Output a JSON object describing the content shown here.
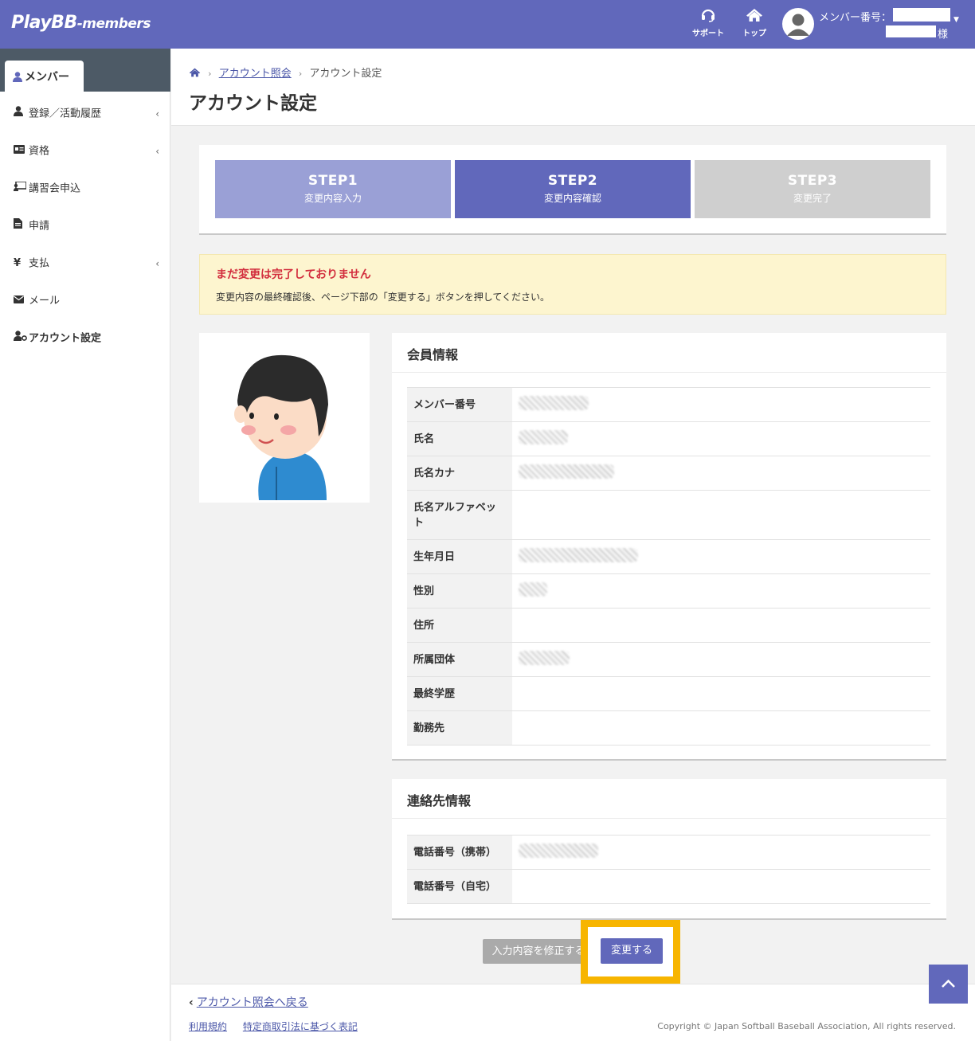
{
  "header": {
    "logo_main": "PlayBB",
    "logo_sub": "-members",
    "support_label": "サポート",
    "top_label": "トップ",
    "member_number_label": "メンバー番号：",
    "honorific": "様"
  },
  "sidebar": {
    "active_tab": "メンバー",
    "items": [
      {
        "label": "登録／活動履歴",
        "icon": "user-icon",
        "has_submenu": true
      },
      {
        "label": "資格",
        "icon": "id-card-icon",
        "has_submenu": true
      },
      {
        "label": "講習会申込",
        "icon": "chalkboard-icon",
        "has_submenu": false
      },
      {
        "label": "申請",
        "icon": "document-icon",
        "has_submenu": false
      },
      {
        "label": "支払",
        "icon": "yen-icon",
        "has_submenu": true
      },
      {
        "label": "メール",
        "icon": "envelope-icon",
        "has_submenu": false
      },
      {
        "label": "アカウント設定",
        "icon": "user-gear-icon",
        "has_submenu": false
      }
    ]
  },
  "breadcrumb": {
    "link": "アカウント照会",
    "current": "アカウント設定"
  },
  "page_title": "アカウント設定",
  "steps": [
    {
      "title": "STEP1",
      "sub": "変更内容入力",
      "color": "#9aa0d6"
    },
    {
      "title": "STEP2",
      "sub": "変更内容確認",
      "color": "#6168bb"
    },
    {
      "title": "STEP3",
      "sub": "変更完了",
      "color": "#cfcfcf"
    }
  ],
  "notice": {
    "title": "まだ変更は完了しておりません",
    "text": "変更内容の最終確認後、ページ下部の「変更する」ボタンを押してください。"
  },
  "member_info": {
    "heading": "会員情報",
    "rows": [
      {
        "label": "メンバー番号"
      },
      {
        "label": "氏名"
      },
      {
        "label": "氏名カナ"
      },
      {
        "label": "氏名アルファベット"
      },
      {
        "label": "生年月日"
      },
      {
        "label": "性別"
      },
      {
        "label": "住所"
      },
      {
        "label": "所属団体"
      },
      {
        "label": "最終学歴"
      },
      {
        "label": "勤務先"
      }
    ]
  },
  "contact_info": {
    "heading": "連絡先情報",
    "rows": [
      {
        "label": "電話番号（携帯）"
      },
      {
        "label": "電話番号（自宅）"
      }
    ]
  },
  "buttons": {
    "fix": "入力内容を修正する",
    "change": "変更する"
  },
  "footer": {
    "back_link": "アカウント照会へ戻る",
    "terms": "利用規約",
    "commerce": "特定商取引法に基づく表記",
    "copyright": "Copyright © Japan Softball Baseball Association, All rights reserved."
  },
  "colors": {
    "brand": "#6168bb",
    "notice_bg": "#fdf5cf",
    "alert_text": "#d22d3d",
    "highlight": "#f7b500"
  }
}
